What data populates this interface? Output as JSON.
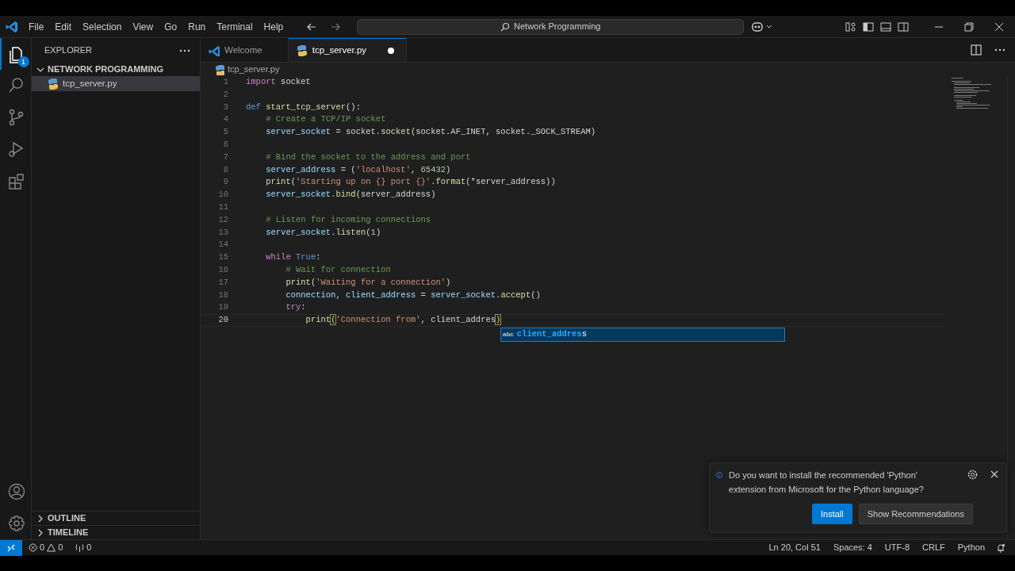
{
  "title_bar": {
    "menus": [
      "File",
      "Edit",
      "Selection",
      "View",
      "Go",
      "Run",
      "Terminal",
      "Help"
    ],
    "search": "Network Programming"
  },
  "activity_bar": {
    "items": [
      {
        "kind": "explorer",
        "selected": true,
        "badge": "1"
      },
      {
        "kind": "search",
        "selected": false
      },
      {
        "kind": "source-control",
        "selected": false
      },
      {
        "kind": "run",
        "selected": false
      },
      {
        "kind": "extensions",
        "selected": false
      }
    ],
    "bottom": [
      {
        "kind": "account"
      },
      {
        "kind": "settings"
      }
    ]
  },
  "sidebar": {
    "title": "EXPLORER",
    "folder": {
      "label": "NETWORK PROGRAMMING",
      "expanded": true,
      "children": [
        {
          "label": "tcp_server.py",
          "selected": true
        }
      ]
    },
    "sections": [
      {
        "label": "OUTLINE",
        "expanded": false
      },
      {
        "label": "TIMELINE",
        "expanded": false
      }
    ]
  },
  "tabs": [
    {
      "label": "Welcome",
      "kind": "welcome",
      "selected": false,
      "modified": false
    },
    {
      "label": "tcp_server.py",
      "kind": "python",
      "selected": true,
      "modified": true
    }
  ],
  "breadcrumb": "tcp_server.py",
  "editor": {
    "lines": [
      {
        "number": "1",
        "current": false,
        "tokens": [
          {
            "t": "import",
            "kind": "keyword"
          },
          {
            "t": " socket",
            "kind": "plain"
          }
        ]
      },
      {
        "number": "2",
        "current": false
      },
      {
        "number": "3",
        "current": false,
        "tokens": [
          {
            "t": "def",
            "kind": "storage"
          },
          {
            "t": " start_tcp_server",
            "kind": "function"
          },
          {
            "t": "():",
            "kind": "plain"
          }
        ]
      },
      {
        "number": "4",
        "current": false,
        "tokens": [
          {
            "t": "    # Create a TCP/IP socket",
            "kind": "comment"
          }
        ]
      },
      {
        "number": "5",
        "current": false,
        "tokens": [
          {
            "t": "    server_socket",
            "kind": "variable"
          },
          {
            "t": " = socket.",
            "kind": "plain"
          },
          {
            "t": "socket",
            "kind": "function"
          },
          {
            "t": "(socket.AF_INET, socket._SOCK_STREAM)",
            "kind": "plain"
          }
        ]
      },
      {
        "number": "6",
        "current": false
      },
      {
        "number": "7",
        "current": false,
        "tokens": [
          {
            "t": "    # Bind the socket to the address and port",
            "kind": "comment"
          }
        ]
      },
      {
        "number": "8",
        "current": false,
        "tokens": [
          {
            "t": "    server_address",
            "kind": "variable"
          },
          {
            "t": " = (",
            "kind": "plain"
          },
          {
            "t": "'localhost'",
            "kind": "string"
          },
          {
            "t": ", ",
            "kind": "plain"
          },
          {
            "t": "65432",
            "kind": "number"
          },
          {
            "t": ")",
            "kind": "plain"
          }
        ]
      },
      {
        "number": "9",
        "current": false,
        "tokens": [
          {
            "t": "    print",
            "kind": "function"
          },
          {
            "t": "(",
            "kind": "plain"
          },
          {
            "t": "'Starting up on {} port {}'",
            "kind": "string"
          },
          {
            "t": ".",
            "kind": "plain"
          },
          {
            "t": "format",
            "kind": "function"
          },
          {
            "t": "(*server_address))",
            "kind": "plain"
          }
        ]
      },
      {
        "number": "10",
        "current": false,
        "tokens": [
          {
            "t": "    server_socket",
            "kind": "variable"
          },
          {
            "t": ".",
            "kind": "plain"
          },
          {
            "t": "bind",
            "kind": "function"
          },
          {
            "t": "(server_address)",
            "kind": "plain"
          }
        ]
      },
      {
        "number": "11",
        "current": false
      },
      {
        "number": "12",
        "current": false,
        "tokens": [
          {
            "t": "    # Listen for incoming connections",
            "kind": "comment"
          }
        ]
      },
      {
        "number": "13",
        "current": false,
        "tokens": [
          {
            "t": "    server_socket",
            "kind": "variable"
          },
          {
            "t": ".",
            "kind": "plain"
          },
          {
            "t": "listen",
            "kind": "function"
          },
          {
            "t": "(",
            "kind": "plain"
          },
          {
            "t": "1",
            "kind": "number"
          },
          {
            "t": ")",
            "kind": "plain"
          }
        ]
      },
      {
        "number": "14",
        "current": false
      },
      {
        "number": "15",
        "current": false,
        "tokens": [
          {
            "t": "    while",
            "kind": "keyword"
          },
          {
            "t": " True",
            "kind": "storage"
          },
          {
            "t": ":",
            "kind": "plain"
          }
        ]
      },
      {
        "number": "16",
        "current": false,
        "tokens": [
          {
            "t": "        # Wait for connection",
            "kind": "comment"
          }
        ]
      },
      {
        "number": "17",
        "current": false,
        "tokens": [
          {
            "t": "        print",
            "kind": "function"
          },
          {
            "t": "(",
            "kind": "plain"
          },
          {
            "t": "'Waiting for a connection'",
            "kind": "string"
          },
          {
            "t": ")",
            "kind": "plain"
          }
        ]
      },
      {
        "number": "18",
        "current": false,
        "tokens": [
          {
            "t": "        connection, client_address",
            "kind": "variable"
          },
          {
            "t": " = ",
            "kind": "plain"
          },
          {
            "t": "server_socket",
            "kind": "variable"
          },
          {
            "t": ".",
            "kind": "plain"
          },
          {
            "t": "accept",
            "kind": "function"
          },
          {
            "t": "()",
            "kind": "plain"
          }
        ]
      },
      {
        "number": "19",
        "current": false,
        "tokens": [
          {
            "t": "        try",
            "kind": "keyword"
          },
          {
            "t": ":",
            "kind": "plain"
          }
        ]
      },
      {
        "number": "20",
        "current": true,
        "tokens": [
          {
            "t": "            print",
            "kind": "function"
          },
          {
            "t": "(",
            "kind": "bracket-match"
          },
          {
            "t": "'Connection from'",
            "kind": "string"
          },
          {
            "t": ", client_addres",
            "kind": "plain"
          },
          {
            "t": ")",
            "kind": "bracket-match"
          }
        ]
      }
    ]
  },
  "suggestion": {
    "kind_label": "abc",
    "match": "client_addres",
    "rest": "s"
  },
  "notification": {
    "message": "Do you want to install the recommended 'Python' extension from Microsoft for the Python language?",
    "actions": [
      {
        "label": "Install",
        "primary": true
      },
      {
        "label": "Show Recommendations",
        "primary": false
      }
    ]
  },
  "status_bar": {
    "errors": "0",
    "warnings": "0",
    "ports": "0",
    "items": [
      "Ln 20, Col 51",
      "Spaces: 4",
      "UTF-8",
      "CRLF",
      "Python"
    ]
  }
}
